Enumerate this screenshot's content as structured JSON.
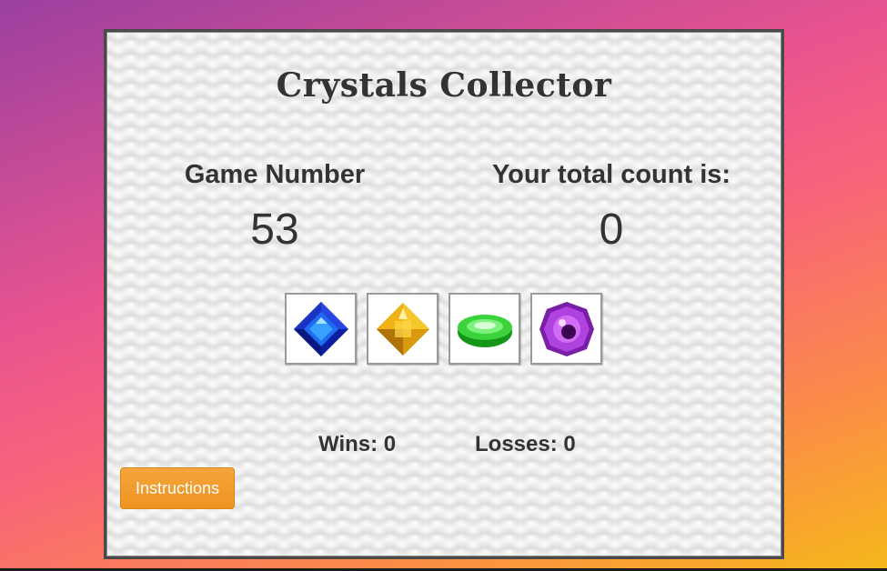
{
  "game": {
    "title": "Crystals Collector",
    "game_number_label": "Game Number",
    "game_number_value": "53",
    "total_label": "Your total count is:",
    "total_value": "0",
    "wins_text": "Wins: 0",
    "losses_text": "Losses: 0",
    "instructions_label": "Instructions"
  },
  "crystals": [
    {
      "name": "blue-crystal",
      "color": "#1a3fd8"
    },
    {
      "name": "yellow-crystal",
      "color": "#f0b81a"
    },
    {
      "name": "green-crystal",
      "color": "#3fd23f"
    },
    {
      "name": "purple-crystal",
      "color": "#a52fd6"
    }
  ],
  "colors": {
    "background_top_left": "#9b3fa0",
    "background_mid": "#f8647a",
    "background_bottom_right": "#f6b81a",
    "button_orange": "#f19a2b",
    "text_dark": "#333333"
  }
}
